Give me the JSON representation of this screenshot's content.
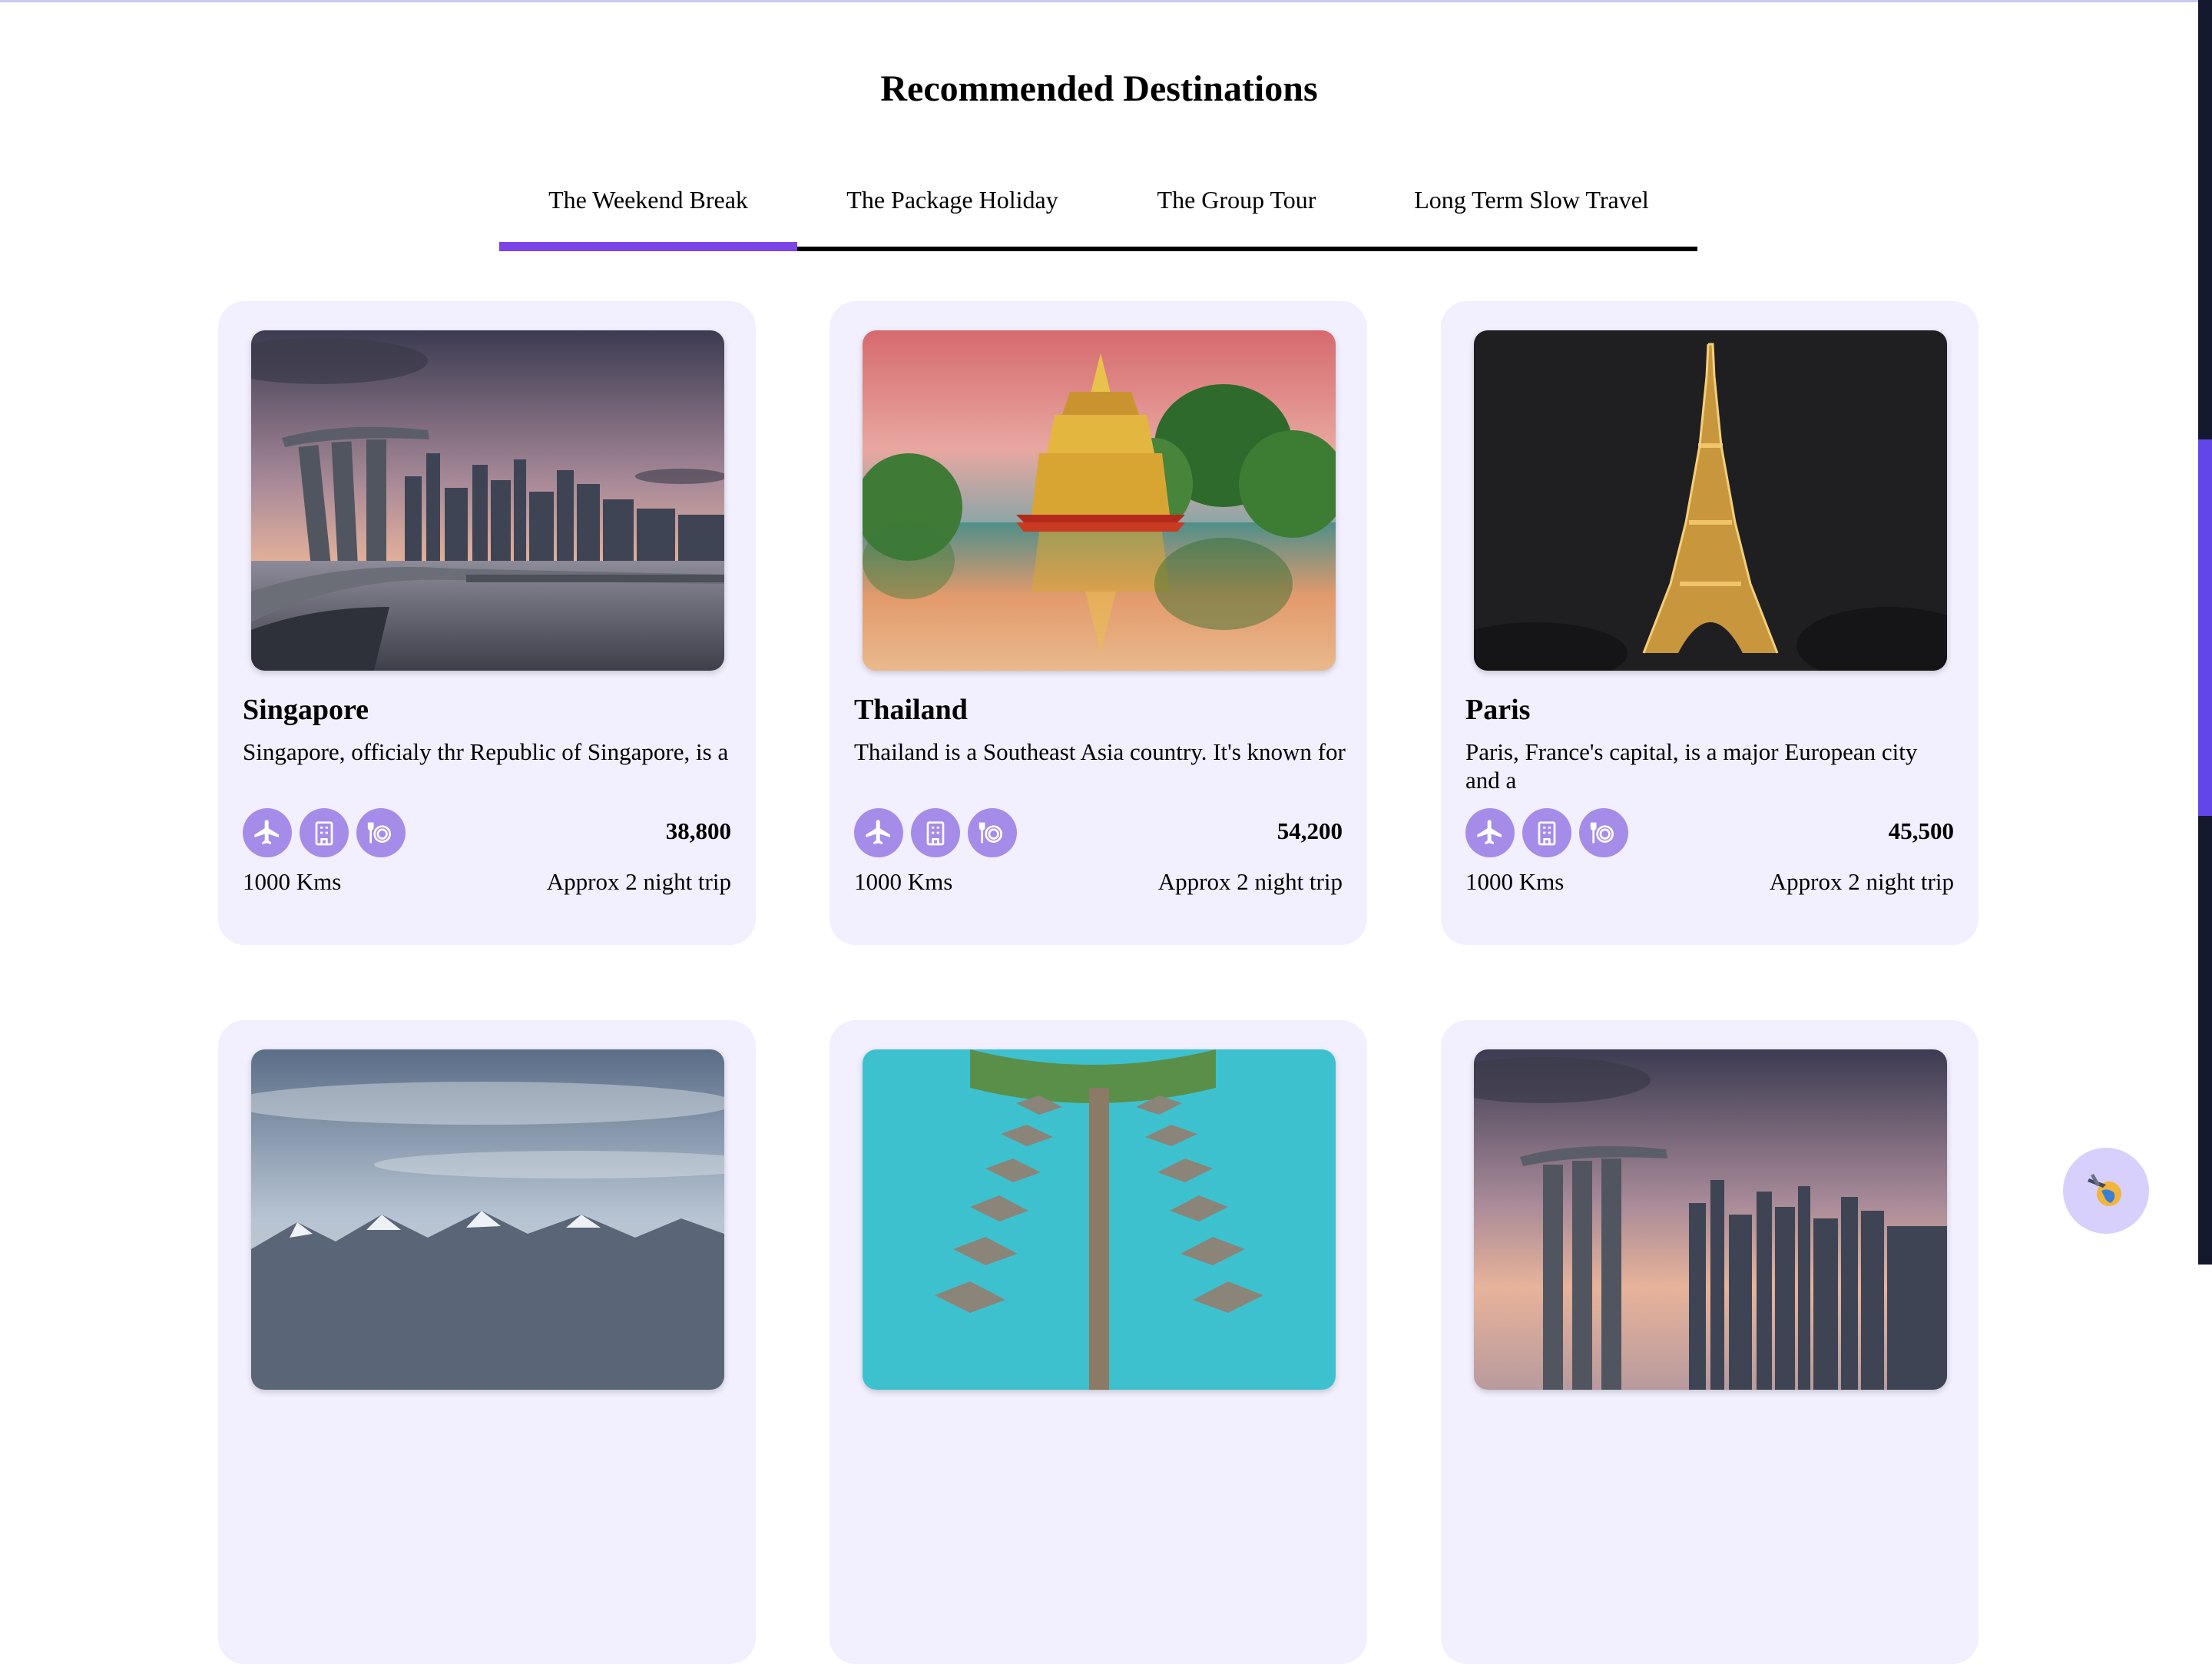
{
  "page": {
    "title": "Recommended Destinations"
  },
  "tabs": [
    {
      "label": "The Weekend Break",
      "active": true
    },
    {
      "label": "The Package Holiday",
      "active": false
    },
    {
      "label": "The Group Tour",
      "active": false
    },
    {
      "label": "Long Term Slow Travel",
      "active": false
    }
  ],
  "colors": {
    "accent": "#7b44e4",
    "card_bg": "#f2effe",
    "icon_bg": "#a58ce8",
    "fab_bg": "#d7d0fc"
  },
  "amenity_icons": [
    "airplane-icon",
    "hotel-icon",
    "meal-icon"
  ],
  "cards": [
    {
      "title": "Singapore",
      "description": "Singapore, officialy thr Republic of Singapore, is a",
      "price": "38,800",
      "distance": "1000 Kms",
      "duration": "Approx 2 night trip",
      "photo": "singapore-skyline-sunset"
    },
    {
      "title": "Thailand",
      "description": "Thailand is a Southeast Asia country. It's known for",
      "price": "54,200",
      "distance": "1000 Kms",
      "duration": "Approx 2 night trip",
      "photo": "golden-temple-reflection"
    },
    {
      "title": "Paris",
      "description": "Paris, France's capital, is a major European city and a",
      "price": "45,500",
      "distance": "1000 Kms",
      "duration": "Approx 2 night trip",
      "photo": "eiffel-tower-night"
    },
    {
      "photo": "mountain-range-clouds"
    },
    {
      "photo": "overwater-bungalows"
    },
    {
      "photo": "singapore-skyline-sunset"
    }
  ],
  "fab": {
    "icon": "travel-globe-icon"
  }
}
